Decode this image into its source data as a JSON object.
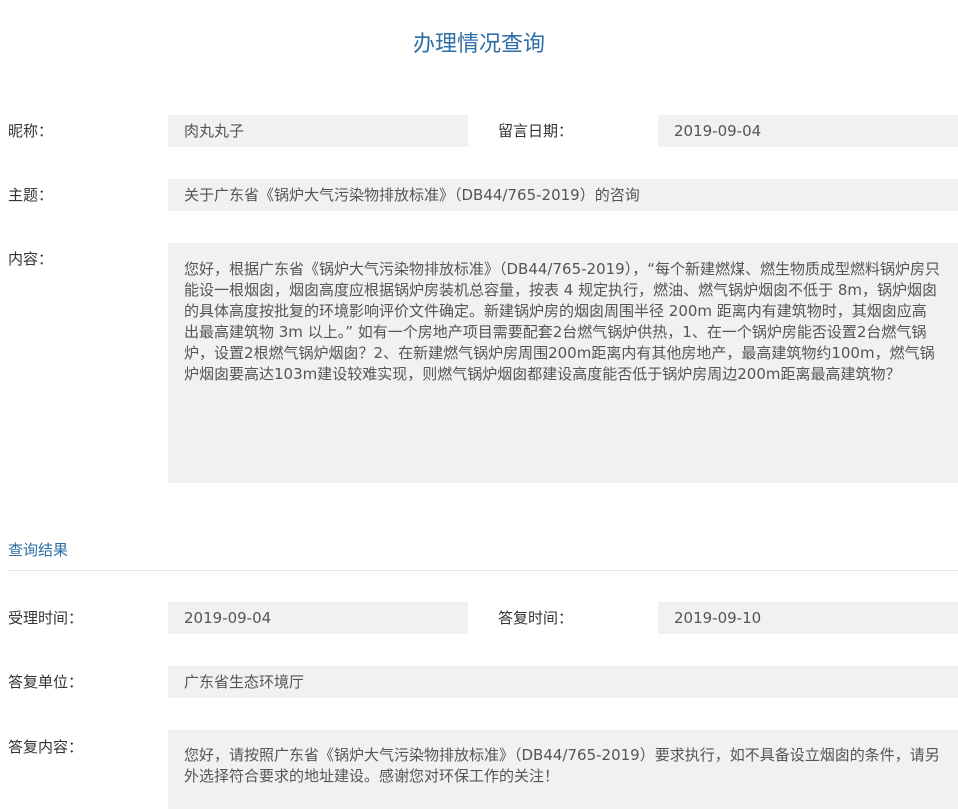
{
  "page": {
    "title": "办理情况查询"
  },
  "inquiry": {
    "nickname_label": "昵称：",
    "nickname_value": "肉丸丸子",
    "date_label": "留言日期：",
    "date_value": "2019-09-04",
    "subject_label": "主题：",
    "subject_value": "关于广东省《锅炉大气污染物排放标准》（DB44/765-2019）的咨询",
    "content_label": "内容：",
    "content_value": "您好，根据广东省《锅炉大气污染物排放标准》（DB44/765-2019），“每个新建燃煤、燃生物质成型燃料锅炉房只能设一根烟囱，烟囱高度应根据锅炉房装机总容量，按表 4 规定执行，燃油、燃气锅炉烟囱不低于 8m，锅炉烟囱的具体高度按批复的环境影响评价文件确定。新建锅炉房的烟囱周围半径 200m 距离内有建筑物时，其烟囱应高出最高建筑物 3m 以上。” 如有一个房地产项目需要配套2台燃气锅炉供热，1、在一个锅炉房能否设置2台燃气锅炉，设置2根燃气锅炉烟囱？2、在新建燃气锅炉房周围200m距离内有其他房地产，最高建筑物约100m，燃气锅炉烟囱要高达103m建设较难实现，则燃气锅炉烟囱都建设高度能否低于锅炉房周边200m距离最高建筑物？"
  },
  "result": {
    "section_title": "查询结果",
    "accept_time_label": "受理时间：",
    "accept_time_value": "2019-09-04",
    "reply_time_label": "答复时间：",
    "reply_time_value": "2019-09-10",
    "reply_unit_label": "答复单位：",
    "reply_unit_value": "广东省生态环境厅",
    "reply_content_label": "答复内容：",
    "reply_content_value": "您好，请按照广东省《锅炉大气污染物排放标准》（DB44/765-2019）要求执行，如不具备设立烟囱的条件，请另外选择符合要求的地址建设。感谢您对环保工作的关注！"
  },
  "colors": {
    "title_blue": "#2e6ea6",
    "field_bg": "#f1f1f1",
    "divider": "#e3e3e3"
  }
}
